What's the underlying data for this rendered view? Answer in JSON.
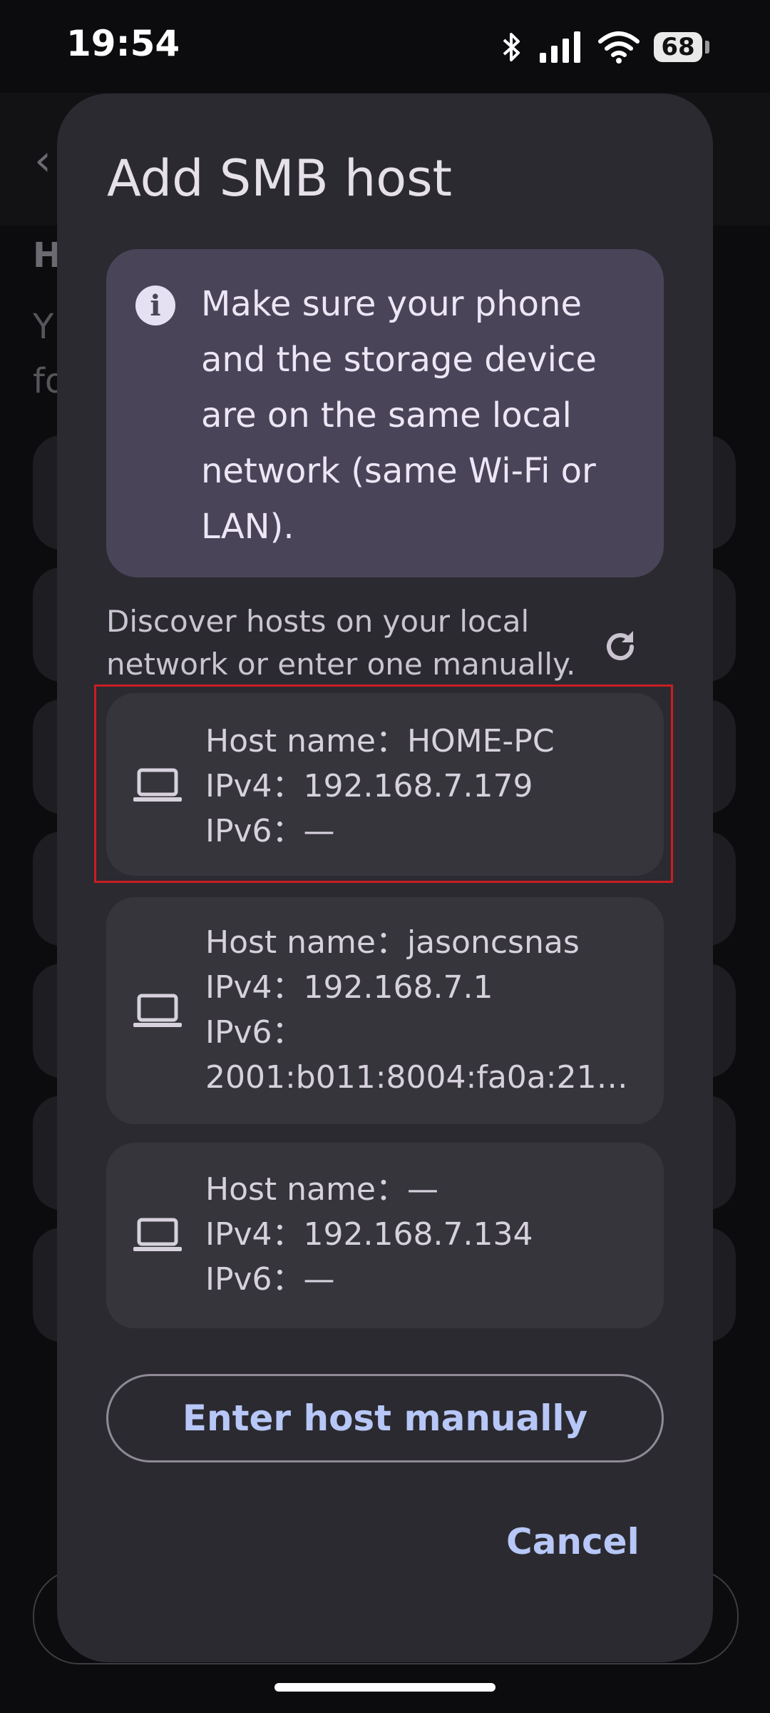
{
  "status_bar": {
    "time": "19:54",
    "battery": "68"
  },
  "dialog": {
    "title": "Add SMB host",
    "info": "Make sure your phone and the storage device are on the same local network (same Wi-Fi or LAN).",
    "discover": "Discover hosts on your local network or enter one manually.",
    "hosts": [
      {
        "hostname": "Host name：HOME-PC",
        "ipv4": "IPv4：192.168.7.179",
        "ipv6": "IPv6：—"
      },
      {
        "hostname": "Host name：jasoncsnas",
        "ipv4": "IPv4：192.168.7.1",
        "ipv6_label": "IPv6：",
        "ipv6_value": "2001:b011:8004:fa0a:211:…"
      },
      {
        "hostname": "Host name：—",
        "ipv4": "IPv4：192.168.7.134",
        "ipv6": "IPv6：—"
      }
    ],
    "enter_manually": "Enter host manually",
    "cancel": "Cancel"
  },
  "background": {
    "heading": "H",
    "desc_line1": "Y",
    "desc_line2": "fo"
  },
  "colors": {
    "dialog": "#2b2a30",
    "info": "#4a4459",
    "accent": "#b7c7f7",
    "highlight": "#c81e24"
  },
  "icons": [
    "bluetooth-icon",
    "signal-icon",
    "wifi-icon",
    "battery-icon",
    "info-icon",
    "refresh-icon",
    "laptop-icon"
  ]
}
